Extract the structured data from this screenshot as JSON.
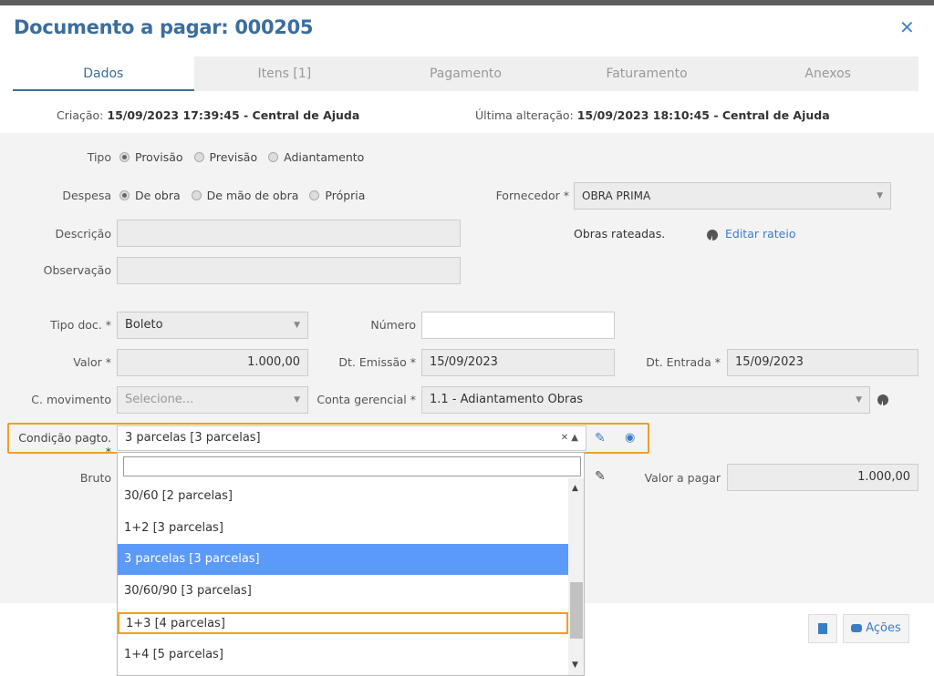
{
  "header": {
    "title": "Documento a pagar: 000205",
    "close_glyph": "✕"
  },
  "tabs": [
    {
      "label": "Dados"
    },
    {
      "label": "Itens [1]"
    },
    {
      "label": "Pagamento"
    },
    {
      "label": "Faturamento"
    },
    {
      "label": "Anexos"
    }
  ],
  "meta": {
    "created_label": "Criação:",
    "created_value": "15/09/2023 17:39:45 - Central de Ajuda",
    "updated_label": "Última alteração:",
    "updated_value": "15/09/2023 18:10:45 - Central de Ajuda"
  },
  "form": {
    "tipo_label": "Tipo",
    "tipo_options": [
      "Provisão",
      "Previsão",
      "Adiantamento"
    ],
    "despesa_label": "Despesa",
    "despesa_options": [
      "De obra",
      "De mão de obra",
      "Própria"
    ],
    "fornecedor_label": "Fornecedor *",
    "fornecedor_value": "OBRA PRIMA",
    "obras_rateadas": "Obras rateadas.",
    "editar_rateio": "Editar rateio",
    "descricao_label": "Descrição",
    "observacao_label": "Observação",
    "tipo_doc_label": "Tipo doc. *",
    "tipo_doc_value": "Boleto",
    "numero_label": "Número",
    "valor_label": "Valor *",
    "valor_value": "1.000,00",
    "dt_emissao_label": "Dt. Emissão *",
    "dt_emissao_value": "15/09/2023",
    "dt_entrada_label": "Dt. Entrada *",
    "dt_entrada_value": "15/09/2023",
    "c_movimento_label": "C. movimento",
    "c_movimento_placeholder": "Selecione...",
    "conta_gerencial_label": "Conta gerencial *",
    "conta_gerencial_value": "1.1 - Adiantamento Obras",
    "condicao_label": "Condição pagto. *",
    "condicao_value": "3 parcelas [3 parcelas]",
    "bruto_label": "Bruto",
    "valor_pagar_label": "Valor a pagar",
    "valor_pagar_value": "1.000,00"
  },
  "dropdown": {
    "items": [
      "30/60 [2 parcelas]",
      "1+2 [3 parcelas]",
      "3 parcelas [3 parcelas]",
      "30/60/90 [3 parcelas]",
      "1+3 [4 parcelas]",
      "1+4 [5 parcelas]"
    ]
  },
  "footer": {
    "acoes_label": "Ações"
  },
  "colors": {
    "accent": "#3b6e9e",
    "highlight": "#f0a020",
    "selected": "#5b9af8"
  }
}
